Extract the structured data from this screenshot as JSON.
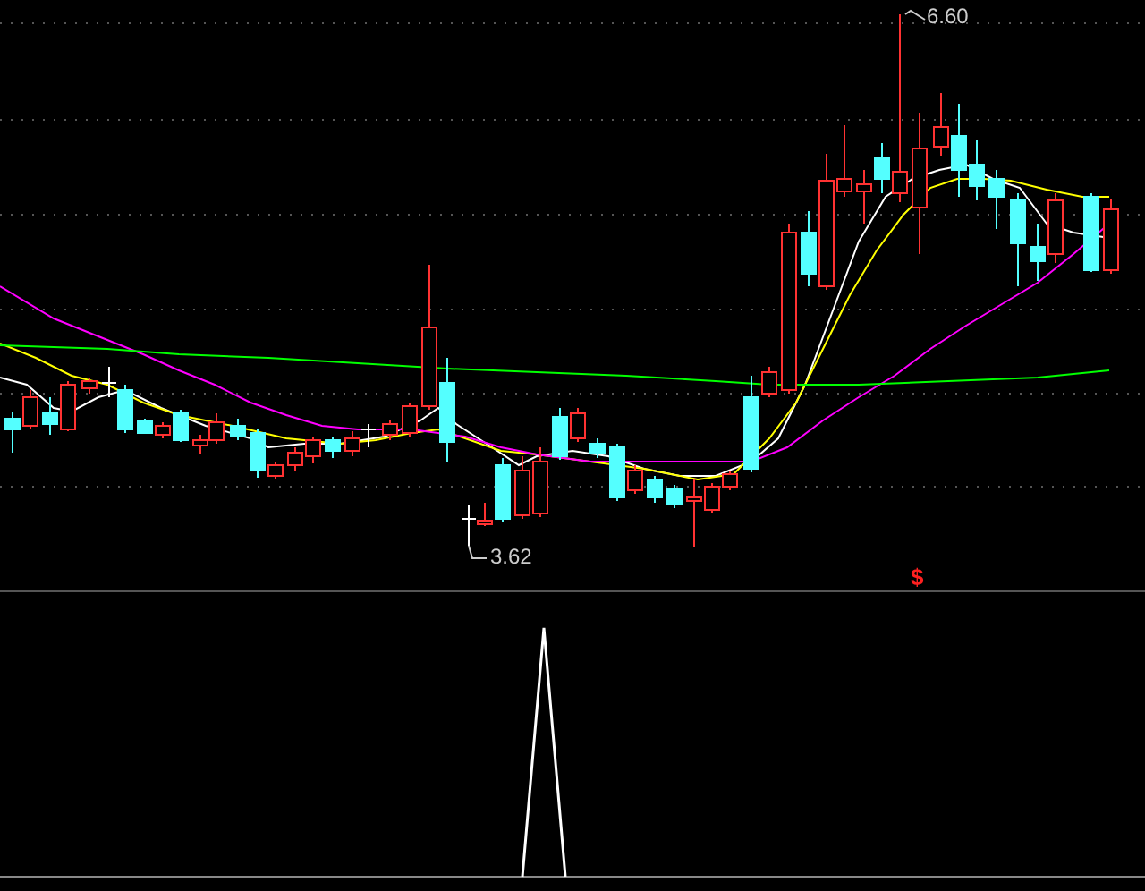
{
  "price_chart": {
    "high_label": "6.60",
    "low_label": "3.62",
    "signal_mark": "$"
  }
}
